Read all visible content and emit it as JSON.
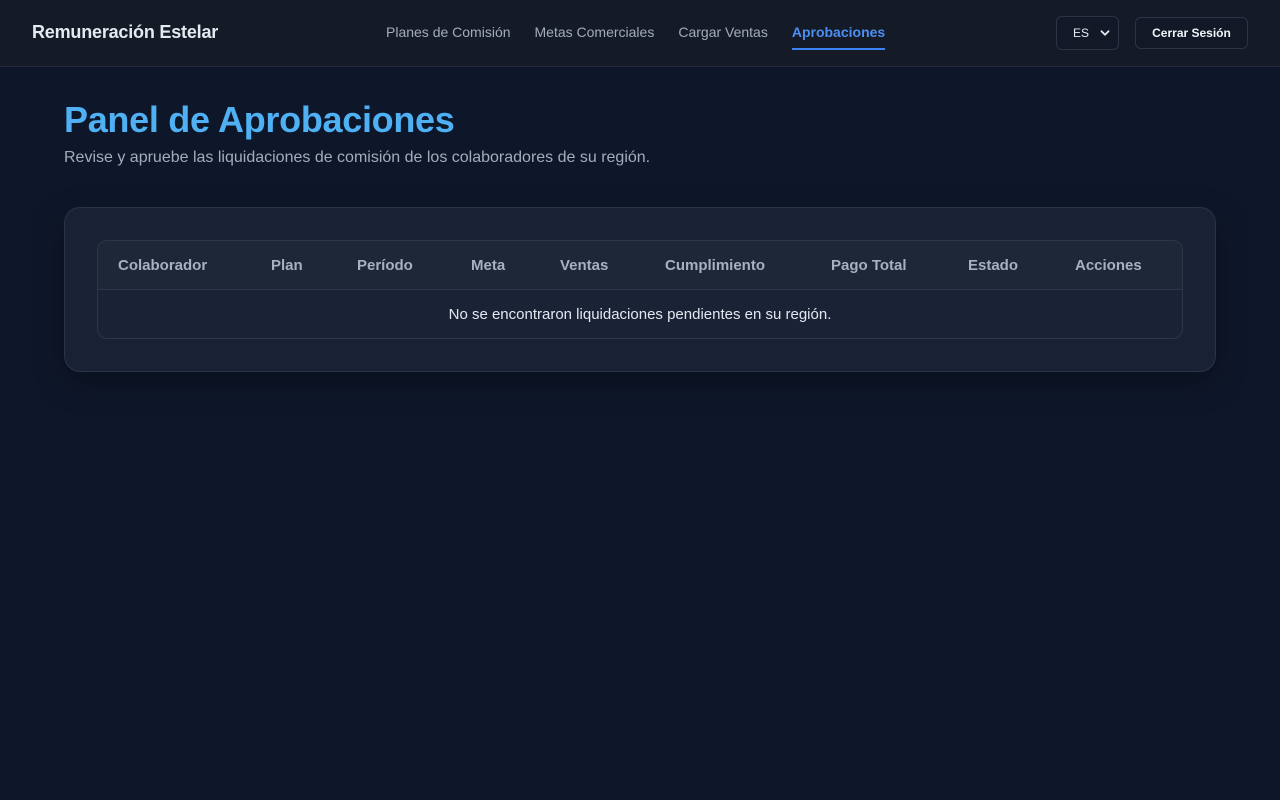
{
  "header": {
    "brand": "Remuneración Estelar",
    "nav": [
      {
        "label": "Planes de Comisión",
        "active": false
      },
      {
        "label": "Metas Comerciales",
        "active": false
      },
      {
        "label": "Cargar Ventas",
        "active": false
      },
      {
        "label": "Aprobaciones",
        "active": true
      }
    ],
    "language": "ES",
    "logout_label": "Cerrar Sesión"
  },
  "main": {
    "title": "Panel de Aprobaciones",
    "subtitle": "Revise y apruebe las liquidaciones de comisión de los colaboradores de su región."
  },
  "table": {
    "columns": [
      "Colaborador",
      "Plan",
      "Período",
      "Meta",
      "Ventas",
      "Cumplimiento",
      "Pago Total",
      "Estado",
      "Acciones"
    ],
    "empty_message": "No se encontraron liquidaciones pendientes en su región."
  },
  "colors": {
    "background": "#0e172a",
    "accent": "#3b82f6",
    "title": "#4fb0f4"
  },
  "icons": {
    "language_dropdown": "chevron-down-icon"
  }
}
